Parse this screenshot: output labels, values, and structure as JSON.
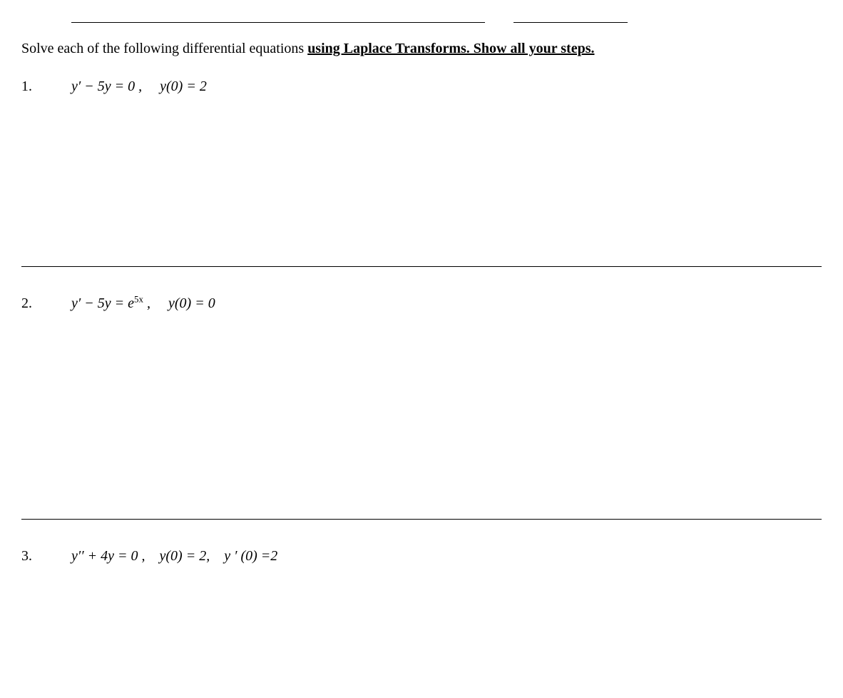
{
  "instructions": {
    "lead": "Solve each of the following differential equations ",
    "emphasis": "using Laplace Transforms.  Show all your steps."
  },
  "problems": [
    {
      "number": "1.",
      "equation": "y′ − 5y = 0 ,",
      "condition": "y(0) = 2"
    },
    {
      "number": "2.",
      "equation_pre": "y′ − 5y = e",
      "equation_sup": "5x",
      "equation_post": " ,",
      "condition": "y(0) =  0"
    },
    {
      "number": "3.",
      "equation": "y′′ + 4y = 0 ,",
      "condition1": "y(0) = 2,",
      "condition2": "y ′ (0) =2"
    }
  ]
}
